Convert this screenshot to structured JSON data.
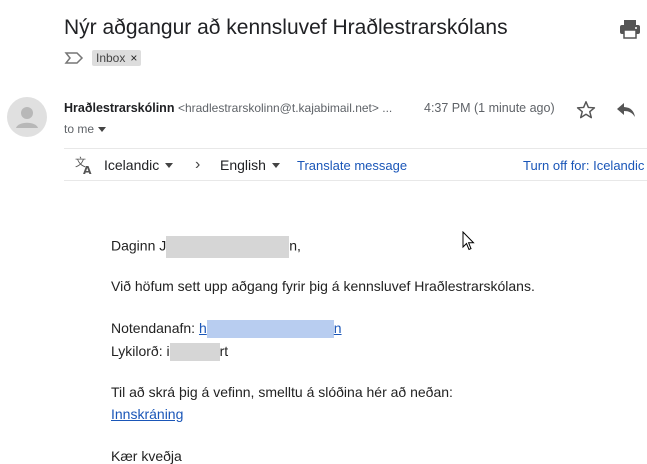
{
  "subject": "Nýr aðgangur að kennsluvef Hraðlestrarskólans",
  "label": {
    "text": "Inbox",
    "remove_glyph": "×"
  },
  "icons": {
    "print": "print-icon",
    "importance": "importance-marker-icon",
    "avatar": "default-avatar-icon",
    "star": "star-icon",
    "reply": "reply-icon",
    "translate": "translate-icon",
    "arrow": "chevron-right-icon"
  },
  "sender": {
    "name": "Hraðlestrarskólinn",
    "email": "<hradlestrarskolinn@t.kajabimail.net> ...",
    "time": "4:37 PM (1 minute ago)",
    "to": "to me"
  },
  "translate_bar": {
    "from_lang": "Icelandic",
    "to_lang": "English",
    "translate_label": "Translate message",
    "turn_off_label": "Turn off for: Icelandic"
  },
  "body": {
    "greeting_prefix": "Daginn J",
    "greeting_suffix": "n,",
    "line1": "Við höfum sett upp aðgang fyrir þig á kennsluvef Hraðlestrarskólans.",
    "username_label": "Notendanafn: ",
    "username_prefix": "h",
    "username_suffix": "n",
    "password_label": "Lykilorð: i",
    "password_suffix": "rt",
    "login_instructions": "Til að skrá þig á vefinn, smelltu á slóðina hér að neðan:",
    "login_link": "Innskráning",
    "closing": "Kær kveðja"
  },
  "colors": {
    "link": "#1a56b8",
    "label_bg": "#dddddd",
    "redaction_grey": "#d6d6d6",
    "redaction_blue": "#b8cdf0"
  }
}
